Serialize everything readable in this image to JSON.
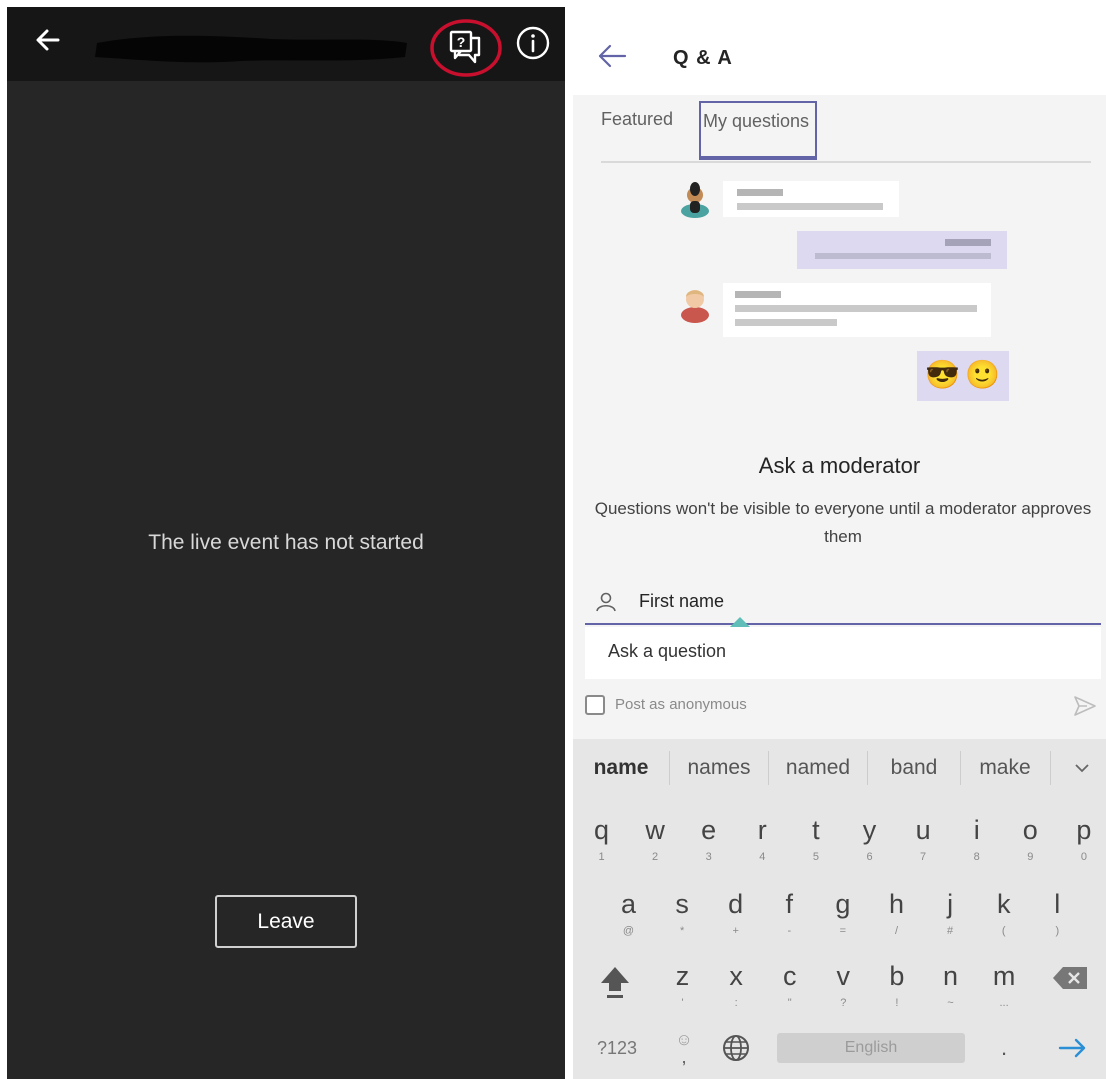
{
  "left_panel": {
    "status_text": "The live event has not started",
    "leave_label": "Leave",
    "colors": {
      "background": "#262626",
      "header": "#161616",
      "highlight_circle": "#c8102e"
    }
  },
  "right_panel": {
    "title": "Q & A",
    "tabs": [
      {
        "label": "Featured",
        "selected": false
      },
      {
        "label": "My questions",
        "selected": true
      }
    ],
    "illustration": {
      "emoji_reactions": [
        "😎",
        "🙂"
      ]
    },
    "ask_title": "Ask a moderator",
    "ask_description": "Questions won't be visible to everyone until a moderator approves them",
    "name_label": "First name",
    "question_placeholder": "Ask a question",
    "anonymous_label": "Post as anonymous",
    "anonymous_checked": false,
    "colors": {
      "accent": "#6264a7",
      "cursor_handle": "#5fbfb8",
      "bubble_purple": "#dcd9f0"
    }
  },
  "keyboard": {
    "suggestions": [
      "name",
      "names",
      "named",
      "band",
      "make"
    ],
    "row1": [
      {
        "key": "q",
        "sub": "1"
      },
      {
        "key": "w",
        "sub": "2"
      },
      {
        "key": "e",
        "sub": "3"
      },
      {
        "key": "r",
        "sub": "4"
      },
      {
        "key": "t",
        "sub": "5"
      },
      {
        "key": "y",
        "sub": "6"
      },
      {
        "key": "u",
        "sub": "7"
      },
      {
        "key": "i",
        "sub": "8"
      },
      {
        "key": "o",
        "sub": "9"
      },
      {
        "key": "p",
        "sub": "0"
      }
    ],
    "row2": [
      {
        "key": "a",
        "sub": "@"
      },
      {
        "key": "s",
        "sub": "*"
      },
      {
        "key": "d",
        "sub": "+"
      },
      {
        "key": "f",
        "sub": "-"
      },
      {
        "key": "g",
        "sub": "="
      },
      {
        "key": "h",
        "sub": "/"
      },
      {
        "key": "j",
        "sub": "#"
      },
      {
        "key": "k",
        "sub": "("
      },
      {
        "key": "l",
        "sub": ")"
      }
    ],
    "row3": [
      {
        "key": "z",
        "sub": "'"
      },
      {
        "key": "x",
        "sub": ":"
      },
      {
        "key": "c",
        "sub": "\""
      },
      {
        "key": "v",
        "sub": "?"
      },
      {
        "key": "b",
        "sub": "!"
      },
      {
        "key": "n",
        "sub": "~"
      },
      {
        "key": "m",
        "sub": "..."
      }
    ],
    "symbols_label": "?123",
    "emoji_label": "☺",
    "comma_label": ",",
    "space_label": "English",
    "period_label": "."
  }
}
